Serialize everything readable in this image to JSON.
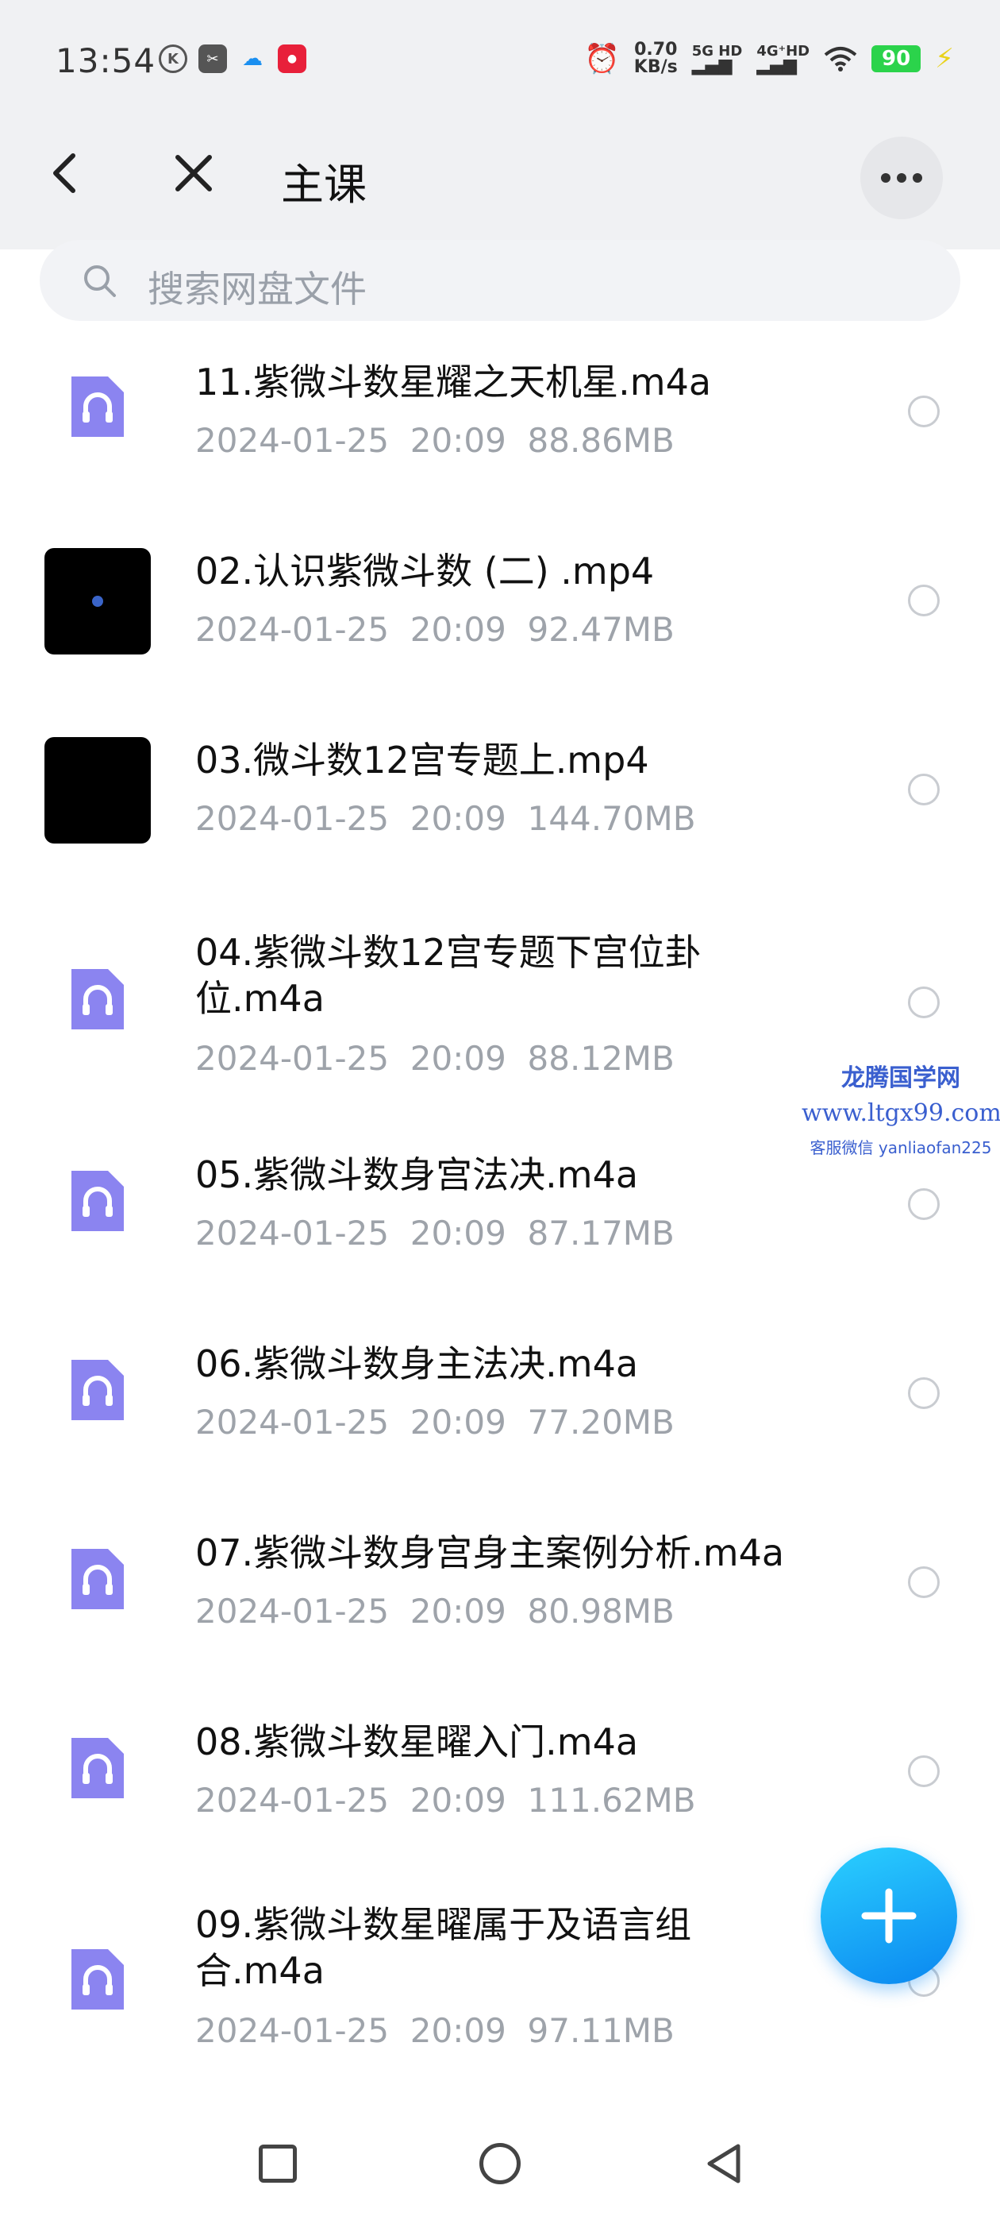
{
  "status_bar": {
    "time": "13:54",
    "speed_value": "0.70",
    "speed_unit": "KB/s",
    "net1": "5G HD",
    "net2": "4G⁺HD",
    "battery": "90"
  },
  "header": {
    "title": "主课"
  },
  "search": {
    "placeholder": "搜索网盘文件"
  },
  "files": [
    {
      "name": "11.紫微斗数星耀之天机星.m4a",
      "date": "2024-01-25",
      "time": "20:09",
      "size": "88.86MB",
      "type": "audio"
    },
    {
      "name": "02.认识紫微斗数 (二) .mp4",
      "date": "2024-01-25",
      "time": "20:09",
      "size": "92.47MB",
      "type": "video"
    },
    {
      "name": "03.微斗数12宫专题上.mp4",
      "date": "2024-01-25",
      "time": "20:09",
      "size": "144.70MB",
      "type": "video"
    },
    {
      "name": "04.紫微斗数12宫专题下宫位卦位.m4a",
      "date": "2024-01-25",
      "time": "20:09",
      "size": "88.12MB",
      "type": "audio"
    },
    {
      "name": "05.紫微斗数身宫法决.m4a",
      "date": "2024-01-25",
      "time": "20:09",
      "size": "87.17MB",
      "type": "audio"
    },
    {
      "name": "06.紫微斗数身主法决.m4a",
      "date": "2024-01-25",
      "time": "20:09",
      "size": "77.20MB",
      "type": "audio"
    },
    {
      "name": "07.紫微斗数身宫身主案例分析.m4a",
      "date": "2024-01-25",
      "time": "20:09",
      "size": "80.98MB",
      "type": "audio"
    },
    {
      "name": "08.紫微斗数星曜入门.m4a",
      "date": "2024-01-25",
      "time": "20:09",
      "size": "111.62MB",
      "type": "audio"
    },
    {
      "name": "09.紫微斗数星曜属于及语言组合.m4a",
      "date": "2024-01-25",
      "time": "20:09",
      "size": "97.11MB",
      "type": "audio"
    }
  ],
  "watermark": {
    "line1": "龙腾国学网",
    "line2": "www.ltgx99.com",
    "line3": "客服微信 yanliaofan225"
  },
  "colors": {
    "accent": "#1a9cf5",
    "audio_icon": "#8b84f0",
    "header_bg": "#f0f1f3"
  }
}
